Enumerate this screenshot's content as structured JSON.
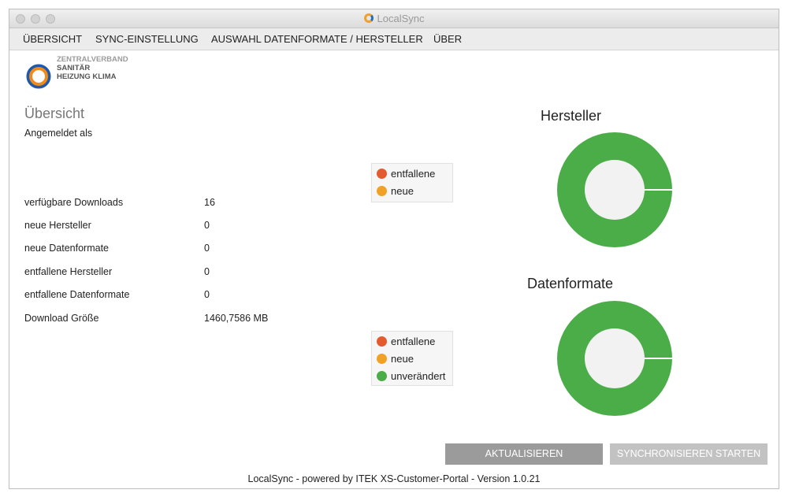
{
  "window": {
    "title": "LocalSync"
  },
  "menu": [
    "ÜBERSICHT",
    "SYNC-EINSTELLUNG",
    "AUSWAHL DATENFORMATE / HERSTELLER",
    "ÜBER"
  ],
  "logo": {
    "line1": "ZENTRALVERBAND",
    "line2": "SANITÄR",
    "line3": "HEIZUNG KLIMA"
  },
  "overview": {
    "heading": "Übersicht",
    "logged_in_label": "Angemeldet als",
    "stats": [
      {
        "label": "verfügbare Downloads",
        "value": "16"
      },
      {
        "label": "neue Hersteller",
        "value": "0"
      },
      {
        "label": "neue Datenformate",
        "value": "0"
      },
      {
        "label": "entfallene Hersteller",
        "value": "0"
      },
      {
        "label": "entfallene Datenformate",
        "value": "0"
      },
      {
        "label": "Download Größe",
        "value": "1460,7586 MB"
      }
    ]
  },
  "legend_top": [
    "entfallene",
    "neue"
  ],
  "legend_bottom": [
    "entfallene",
    "neue",
    "unverändert"
  ],
  "colors": {
    "entfallene": "#e35b2e",
    "neue": "#f1a126",
    "unveraendert": "#4aad48",
    "button": "#9b9b9b",
    "button_disabled": "#bdbdbd"
  },
  "buttons": {
    "refresh": "AKTUALISIEREN",
    "sync": "SYNCHRONISIEREN STARTEN"
  },
  "footer": "LocalSync - powered by ITEK XS-Customer-Portal - Version 1.0.21",
  "chart_data": [
    {
      "type": "pie",
      "title": "Hersteller",
      "categories": [
        "entfallene",
        "neue",
        "unverändert"
      ],
      "values": [
        0,
        0,
        100
      ]
    },
    {
      "type": "pie",
      "title": "Datenformate",
      "categories": [
        "entfallene",
        "neue",
        "unverändert"
      ],
      "values": [
        0,
        0,
        100
      ]
    }
  ]
}
